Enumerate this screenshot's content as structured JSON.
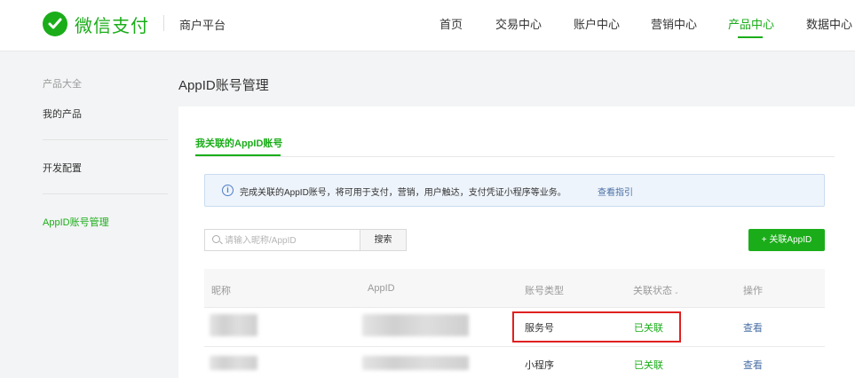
{
  "header": {
    "brand": "微信支付",
    "platform": "商户平台",
    "nav": [
      "首页",
      "交易中心",
      "账户中心",
      "营销中心",
      "产品中心",
      "数据中心"
    ],
    "active_nav": "产品中心"
  },
  "sidebar": {
    "group": "产品大全",
    "items": [
      "我的产品",
      "开发配置",
      "AppID账号管理"
    ]
  },
  "main": {
    "title": "AppID账号管理",
    "tab": "我关联的AppID账号",
    "notice": {
      "text": "完成关联的AppID账号，将可用于支付，营销，用户触达，支付凭证小程序等业务。",
      "link": "查看指引"
    },
    "search": {
      "placeholder": "请输入昵称/AppID",
      "button": "搜索"
    },
    "add_button": "+ 关联AppID",
    "table": {
      "headers": [
        "昵称",
        "AppID",
        "账号类型",
        "关联状态",
        "操作"
      ],
      "rows": [
        {
          "type": "服务号",
          "status": "已关联",
          "action": "查看"
        },
        {
          "type": "小程序",
          "status": "已关联",
          "action": "查看"
        }
      ]
    }
  },
  "colors": {
    "brand_green": "#1aad19",
    "link_blue": "#4a6fa5",
    "highlight_red": "#e02020"
  },
  "icons": [
    "wechat-pay-logo-icon",
    "info-icon",
    "search-icon",
    "sort-chevron-icon"
  ]
}
